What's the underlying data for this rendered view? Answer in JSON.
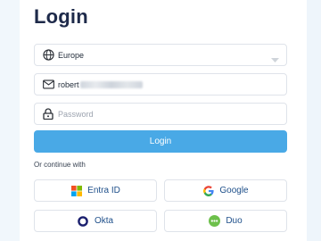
{
  "title": "Login",
  "region": {
    "value": "Europe"
  },
  "email": {
    "value_prefix": "robert"
  },
  "password": {
    "placeholder": "Password"
  },
  "login_button": "Login",
  "continue_text": "Or continue with",
  "providers": [
    {
      "label": "Entra ID",
      "icon": "microsoft-icon"
    },
    {
      "label": "Google",
      "icon": "google-icon"
    },
    {
      "label": "Okta",
      "icon": "okta-icon"
    },
    {
      "label": "Duo",
      "icon": "duo-icon"
    }
  ]
}
